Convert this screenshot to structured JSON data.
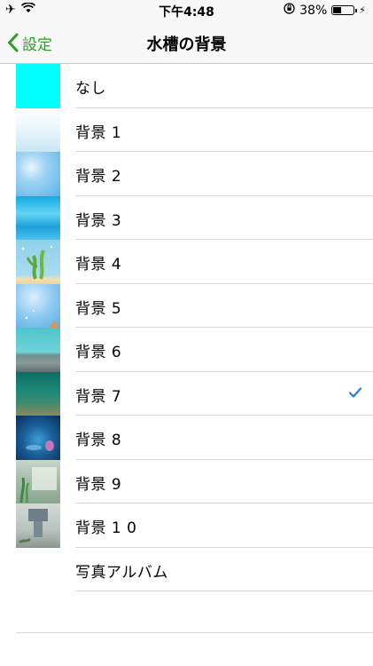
{
  "status": {
    "time": "下午4:48",
    "battery": "38%",
    "battery_level": 0.38
  },
  "nav": {
    "back_label": "設定",
    "title": "水槽の背景"
  },
  "items": [
    {
      "label": "なし",
      "thumb": "none",
      "selected": false
    },
    {
      "label": "背景 1",
      "thumb": "bg1",
      "selected": false
    },
    {
      "label": "背景 2",
      "thumb": "bg2",
      "selected": false
    },
    {
      "label": "背景 3",
      "thumb": "bg3",
      "selected": false
    },
    {
      "label": "背景 4",
      "thumb": "bg4",
      "selected": false
    },
    {
      "label": "背景 5",
      "thumb": "bg5",
      "selected": false
    },
    {
      "label": "背景 6",
      "thumb": "bg6",
      "selected": false
    },
    {
      "label": "背景 7",
      "thumb": "bg7",
      "selected": true
    },
    {
      "label": "背景 8",
      "thumb": "bg8",
      "selected": false
    },
    {
      "label": "背景 9",
      "thumb": "bg9",
      "selected": false
    },
    {
      "label": "背景 1 0",
      "thumb": "bg10",
      "selected": false
    },
    {
      "label": "写真アルバム",
      "thumb": "",
      "selected": false
    }
  ],
  "colors": {
    "accent": "#2e9f27",
    "check": "#1a7fe0"
  }
}
